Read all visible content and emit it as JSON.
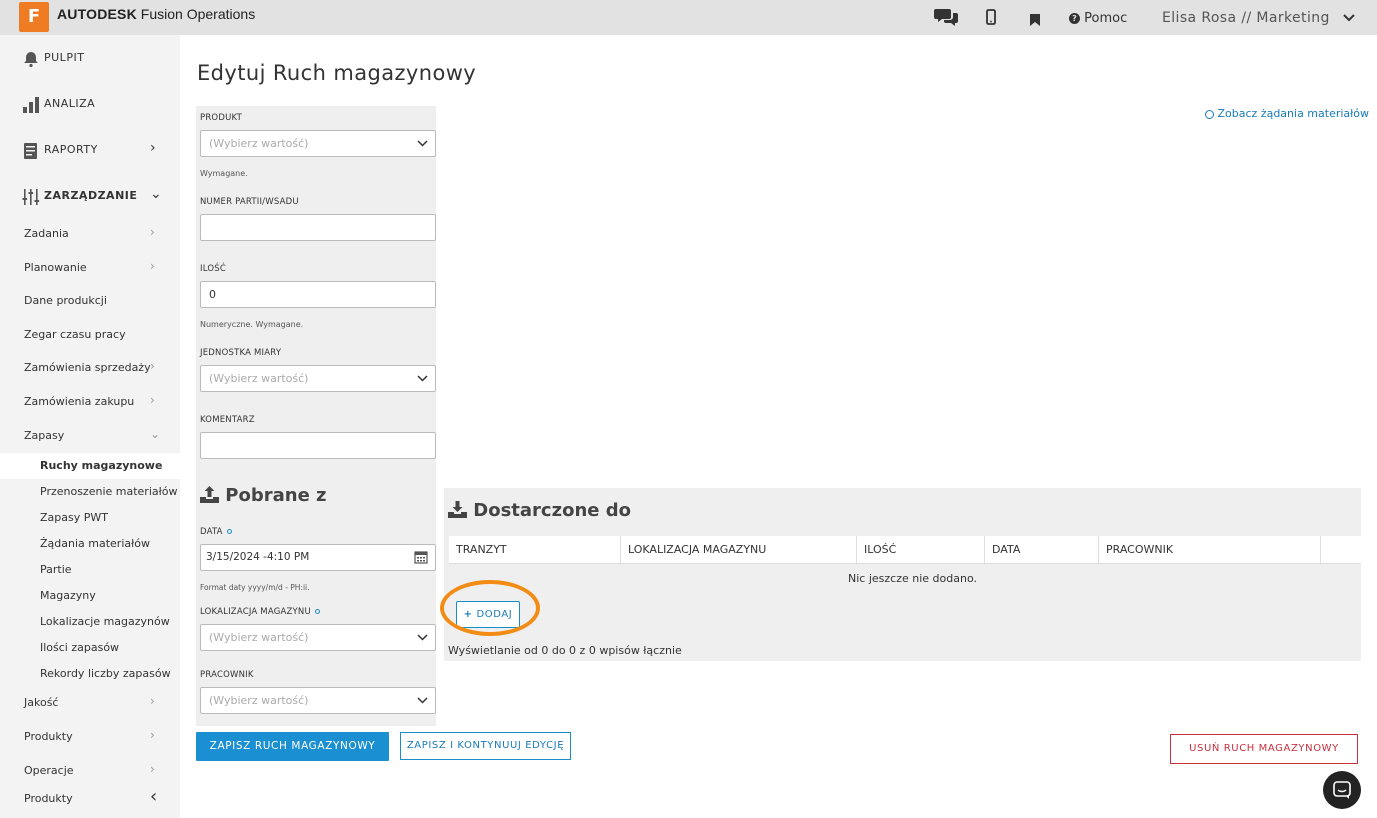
{
  "topbar": {
    "logo_letter": "F",
    "brand_strong": "AUTODESK",
    "brand_rest": "Fusion Operations",
    "help_label": "Pomoc",
    "user_label": "Elisa Rosa // Marketing",
    "icons": [
      "chat-icon",
      "mobile-icon",
      "bookmark-icon",
      "help-icon",
      "chevron-down-icon"
    ]
  },
  "sidebar": {
    "main": [
      {
        "label": "PULPIT",
        "icon": "bell-icon"
      },
      {
        "label": "ANALIZA",
        "icon": "bar-chart-icon"
      },
      {
        "label": "RAPORTY",
        "icon": "report-icon",
        "chevron": "›"
      },
      {
        "label": "ZARZĄDZANIE",
        "icon": "sliders-icon",
        "chevron": "⌄"
      }
    ],
    "sub": [
      {
        "label": "Zadania",
        "chevron": "›"
      },
      {
        "label": "Planowanie",
        "chevron": "›"
      },
      {
        "label": "Dane produkcji",
        "chevron": ""
      },
      {
        "label": "Zegar czasu pracy",
        "chevron": ""
      },
      {
        "label": "Zamówienia sprzedaży",
        "chevron": "›"
      },
      {
        "label": "Zamówienia zakupu",
        "chevron": "›"
      },
      {
        "label": "Zapasy",
        "chevron": "⌄"
      }
    ],
    "third": [
      {
        "label": "Ruchy magazynowe"
      },
      {
        "label": "Przenoszenie materiałów"
      },
      {
        "label": "Zapasy PWT"
      },
      {
        "label": "Żądania materiałów"
      },
      {
        "label": "Partie"
      },
      {
        "label": "Magazyny"
      },
      {
        "label": "Lokalizacje magazynów"
      },
      {
        "label": "Ilości zapasów"
      },
      {
        "label": "Rekordy liczby zapasów"
      }
    ],
    "bottom": [
      {
        "label": "Jakość",
        "chevron": "›"
      },
      {
        "label": "Produkty",
        "chevron": "›"
      },
      {
        "label": "Operacje",
        "chevron": "›"
      },
      {
        "label": "Produkty",
        "chevron": "‹"
      }
    ]
  },
  "page": {
    "title": "Edytuj Ruch magazynowy",
    "link_requests": "Zobacz żądania materiałów"
  },
  "form": {
    "produkt_label": "PRODUKT",
    "produkt_placeholder": "(Wybierz wartość)",
    "produkt_hint": "Wymagane.",
    "partia_label": "NUMER PARTII/WSADU",
    "partia_value": "",
    "ilosc_label": "ILOŚĆ",
    "ilosc_value": "0",
    "ilosc_hint": "Numeryczne. Wymagane.",
    "jm_label": "JEDNOSTKA MIARY",
    "jm_placeholder": "(Wybierz wartość)",
    "komentarz_label": "KOMENTARZ",
    "komentarz_value": ""
  },
  "pobrane": {
    "heading": "Pobrane z",
    "data_label": "DATA",
    "data_value": "3/15/2024 -4:10 PM",
    "data_hint": "Format daty yyyy/m/d - PH:ii.",
    "lok_label": "LOKALIZACJA MAGAZYNU",
    "lok_placeholder": "(Wybierz wartość)",
    "prac_label": "PRACOWNIK",
    "prac_placeholder": "(Wybierz wartość)"
  },
  "dostarczone": {
    "heading": "Dostarczone do",
    "columns": [
      "TRANZYT",
      "LOKALIZACJA MAGAZYNU",
      "ILOŚĆ",
      "DATA",
      "PRACOWNIK"
    ],
    "empty": "Nic jeszcze nie dodano.",
    "add_label": "DODAJ",
    "pager": "Wyświetlanie od 0 do 0 z 0 wpisów łącznie"
  },
  "actions": {
    "save": "ZAPISZ RUCH MAGAZYNOWY",
    "save_continue": "ZAPISZ I KONTYNUUJ EDYCJĘ",
    "delete": "USUŃ RUCH MAGAZYNOWY"
  },
  "colors": {
    "accent": "#1a8fd2",
    "danger": "#c8313e",
    "highlight": "#f28c14",
    "brand": "#ef7c23"
  }
}
